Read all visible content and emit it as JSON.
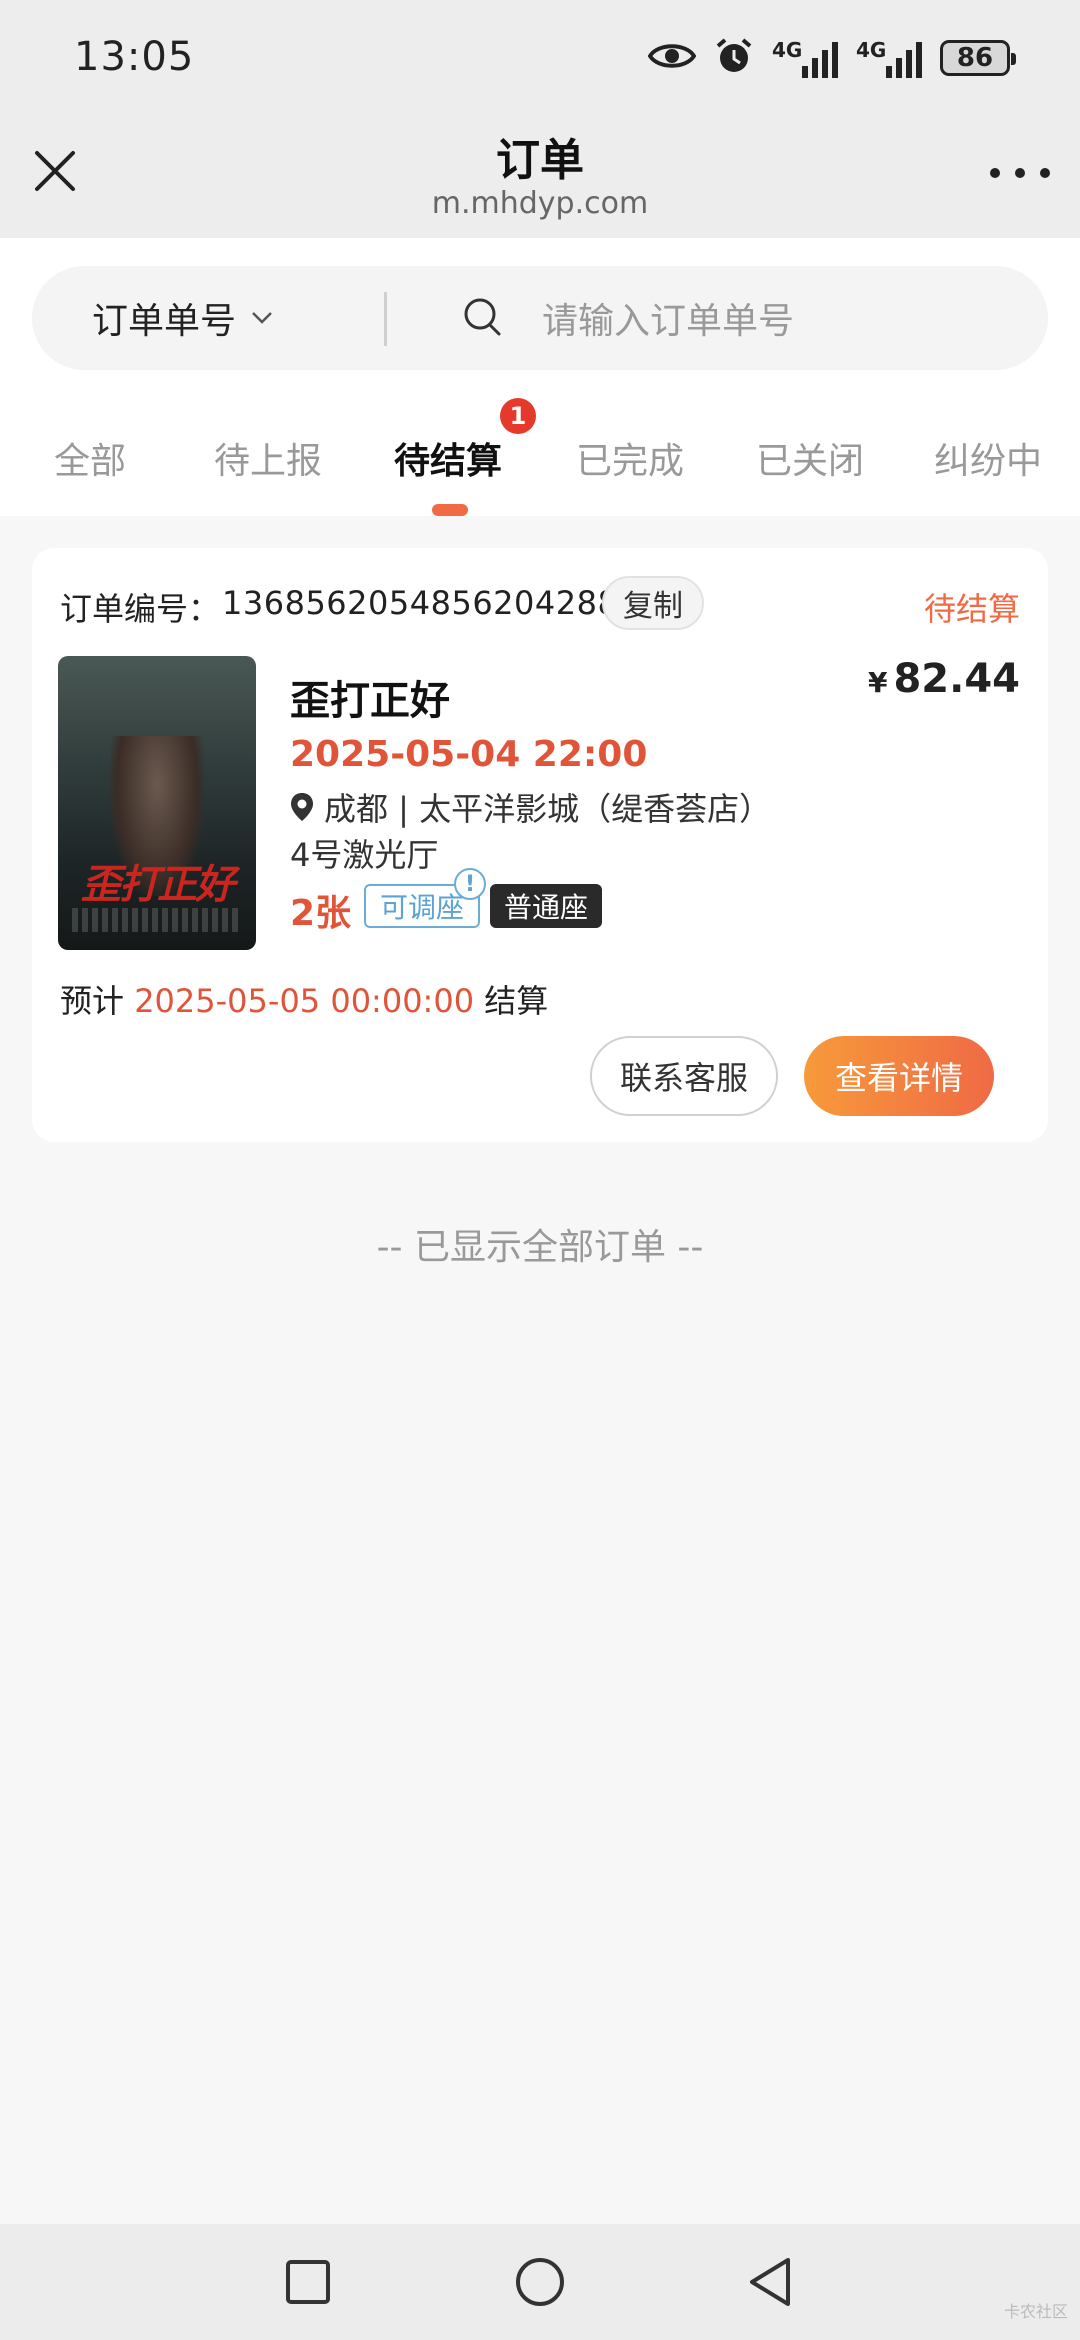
{
  "status_bar": {
    "time": "13:05",
    "icons": [
      "eye-icon",
      "alarm-icon",
      "signal-4g-icon",
      "signal-4g-icon"
    ],
    "network_1": "4G",
    "network_2": "4G",
    "battery": "86"
  },
  "header": {
    "title": "订单",
    "url": "m.mhdyp.com"
  },
  "search": {
    "select_label": "订单单号",
    "placeholder": "请输入订单单号"
  },
  "tabs": [
    {
      "label": "全部"
    },
    {
      "label": "待上报"
    },
    {
      "label": "待结算",
      "active": true,
      "badge": "1"
    },
    {
      "label": "已完成"
    },
    {
      "label": "已关闭"
    },
    {
      "label": "纠纷中"
    }
  ],
  "order": {
    "number_label": "订单编号：",
    "number": "1368562054856204288",
    "copy_label": "复制",
    "status": "待结算",
    "poster_title": "歪打正好",
    "movie_title": "歪打正好",
    "price_symbol": "¥",
    "price": "82.44",
    "show_time": "2025-05-04 22:00",
    "cinema": "成都 | 太平洋影城（缇香荟店）",
    "hall": "4号激光厅",
    "tickets": "2张",
    "tag_adjustable": "可调座",
    "tag_info": "!",
    "tag_seat": "普通座",
    "settle_prefix": "预计",
    "settle_date": "2025-05-05 00:00:00",
    "settle_suffix": "结算",
    "btn_service": "联系客服",
    "btn_detail": "查看详情"
  },
  "footer_note": "-- 已显示全部订单 --",
  "watermark": "卡农社区",
  "colors": {
    "accent": "#ef6a45",
    "accent_gradient_start": "#f79a3a",
    "badge": "#e5392b",
    "tag_blue": "#5aa3d3",
    "background": "#f7f7f7"
  }
}
